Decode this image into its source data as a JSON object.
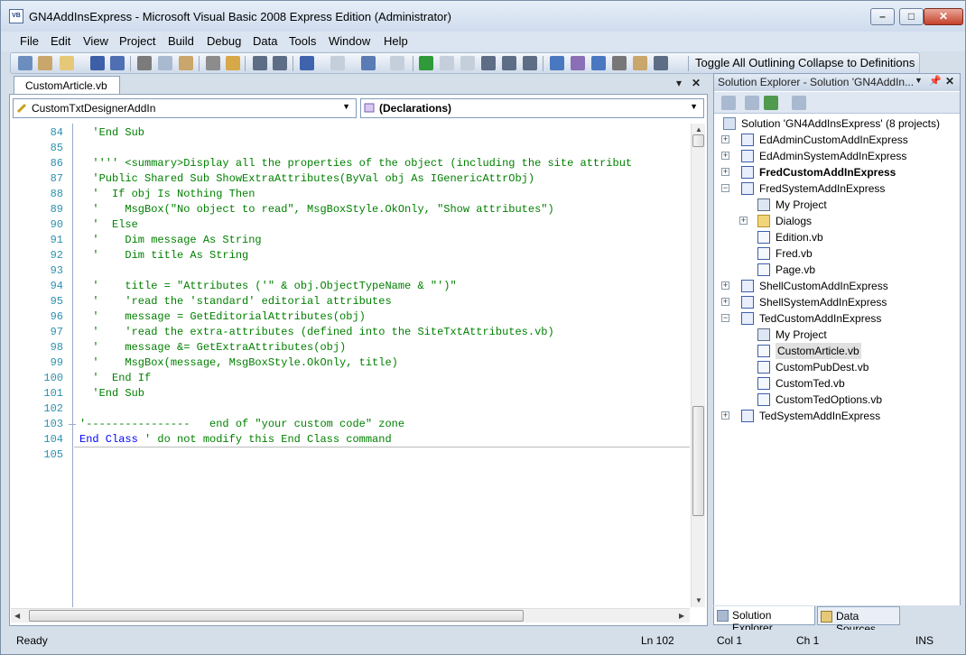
{
  "window": {
    "title": "GN4AddInsExpress - Microsoft Visual Basic 2008 Express Edition (Administrator)",
    "icon_text": "VB",
    "minimize": "–",
    "maximize": "□",
    "close": "✕"
  },
  "menu": [
    "File",
    "Edit",
    "View",
    "Project",
    "Build",
    "Debug",
    "Data",
    "Tools",
    "Window",
    "Help"
  ],
  "toolbar": {
    "toggle_outlining": "Toggle All Outlining",
    "collapse_definitions": "Collapse to Definitions"
  },
  "editor": {
    "tab_label": "CustomArticle.vb",
    "tab_pin": "🔒",
    "class_combo": "CustomTxtDesignerAddIn",
    "method_combo": "(Declarations)",
    "lines": [
      {
        "n": "84",
        "t": "  'End Sub",
        "c": "cmt"
      },
      {
        "n": "85",
        "t": "",
        "c": ""
      },
      {
        "n": "86",
        "t": "  '''' <summary>Display all the properties of the object (including the site attribut",
        "c": "cmt"
      },
      {
        "n": "87",
        "t": "  'Public Shared Sub ShowExtraAttributes(ByVal obj As IGenericAttrObj)",
        "c": "cmt"
      },
      {
        "n": "88",
        "t": "  '  If obj Is Nothing Then",
        "c": "cmt"
      },
      {
        "n": "89",
        "t": "  '    MsgBox(\"No object to read\", MsgBoxStyle.OkOnly, \"Show attributes\")",
        "c": "cmt"
      },
      {
        "n": "90",
        "t": "  '  Else",
        "c": "cmt"
      },
      {
        "n": "91",
        "t": "  '    Dim message As String",
        "c": "cmt"
      },
      {
        "n": "92",
        "t": "  '    Dim title As String",
        "c": "cmt"
      },
      {
        "n": "93",
        "t": "",
        "c": ""
      },
      {
        "n": "94",
        "t": "  '    title = \"Attributes ('\" & obj.ObjectTypeName & \"')\"",
        "c": "cmt"
      },
      {
        "n": "95",
        "t": "  '    'read the 'standard' editorial attributes",
        "c": "cmt"
      },
      {
        "n": "96",
        "t": "  '    message = GetEditorialAttributes(obj)",
        "c": "cmt"
      },
      {
        "n": "97",
        "t": "  '    'read the extra-attributes (defined into the SiteTxtAttributes.vb)",
        "c": "cmt"
      },
      {
        "n": "98",
        "t": "  '    message &= GetExtraAttributes(obj)",
        "c": "cmt"
      },
      {
        "n": "99",
        "t": "  '    MsgBox(message, MsgBoxStyle.OkOnly, title)",
        "c": "cmt"
      },
      {
        "n": "100",
        "t": "  '  End If",
        "c": "cmt"
      },
      {
        "n": "101",
        "t": "  'End Sub",
        "c": "cmt"
      },
      {
        "n": "102",
        "t": "",
        "c": ""
      },
      {
        "n": "103",
        "t": "'----------------   end of \"your custom code\" zone",
        "c": "cmt"
      },
      {
        "n": "104",
        "t": "End Class ' do not modify this End Class command",
        "c": "mix"
      },
      {
        "n": "105",
        "t": "",
        "c": ""
      }
    ],
    "line104_kw": "End Class",
    "line104_cmt": " ' do not modify this End Class command"
  },
  "solution_explorer": {
    "title": "Solution Explorer - Solution 'GN4AddIn...",
    "pin": "ᴥ",
    "items": [
      {
        "label": "Solution 'GN4AddInsExpress' (8 projects)",
        "level": 0,
        "exp": "",
        "icon": "solution-icon",
        "bold": false
      },
      {
        "label": "EdAdminCustomAddInExpress",
        "level": 1,
        "exp": "+",
        "icon": "vb-project-icon",
        "bold": false
      },
      {
        "label": "EdAdminSystemAddInExpress",
        "level": 1,
        "exp": "+",
        "icon": "vb-project-icon",
        "bold": false
      },
      {
        "label": "FredCustomAddInExpress",
        "level": 1,
        "exp": "+",
        "icon": "vb-project-icon",
        "bold": true
      },
      {
        "label": "FredSystemAddInExpress",
        "level": 1,
        "exp": "−",
        "icon": "vb-project-icon",
        "bold": false
      },
      {
        "label": "My Project",
        "level": 2,
        "exp": "",
        "icon": "my-project-icon",
        "bold": false
      },
      {
        "label": "Dialogs",
        "level": 2,
        "exp": "+",
        "icon": "folder-icon",
        "bold": false
      },
      {
        "label": "Edition.vb",
        "level": 2,
        "exp": "",
        "icon": "vb-file-icon",
        "bold": false
      },
      {
        "label": "Fred.vb",
        "level": 2,
        "exp": "",
        "icon": "vb-file-icon",
        "bold": false
      },
      {
        "label": "Page.vb",
        "level": 2,
        "exp": "",
        "icon": "vb-file-icon",
        "bold": false
      },
      {
        "label": "ShellCustomAddInExpress",
        "level": 1,
        "exp": "+",
        "icon": "vb-project-icon",
        "bold": false
      },
      {
        "label": "ShellSystemAddInExpress",
        "level": 1,
        "exp": "+",
        "icon": "vb-project-icon",
        "bold": false
      },
      {
        "label": "TedCustomAddInExpress",
        "level": 1,
        "exp": "−",
        "icon": "vb-project-icon",
        "bold": false
      },
      {
        "label": "My Project",
        "level": 2,
        "exp": "",
        "icon": "my-project-icon",
        "bold": false
      },
      {
        "label": "CustomArticle.vb",
        "level": 2,
        "exp": "",
        "icon": "vb-file-icon",
        "bold": false,
        "selected": true
      },
      {
        "label": "CustomPubDest.vb",
        "level": 2,
        "exp": "",
        "icon": "vb-file-icon",
        "bold": false
      },
      {
        "label": "CustomTed.vb",
        "level": 2,
        "exp": "",
        "icon": "vb-file-icon",
        "bold": false
      },
      {
        "label": "CustomTedOptions.vb",
        "level": 2,
        "exp": "",
        "icon": "vb-file-icon",
        "bold": false
      },
      {
        "label": "TedSystemAddInExpress",
        "level": 1,
        "exp": "+",
        "icon": "vb-project-icon",
        "bold": false
      }
    ],
    "tabs": [
      "Solution Explorer",
      "Data Sources"
    ]
  },
  "status": {
    "message": "Ready",
    "line": "Ln 102",
    "col": "Col 1",
    "ch": "Ch 1",
    "mode": "INS"
  },
  "colors": {
    "comment": "#008000",
    "keyword": "#0000ff",
    "line_number": "#2b91af"
  }
}
